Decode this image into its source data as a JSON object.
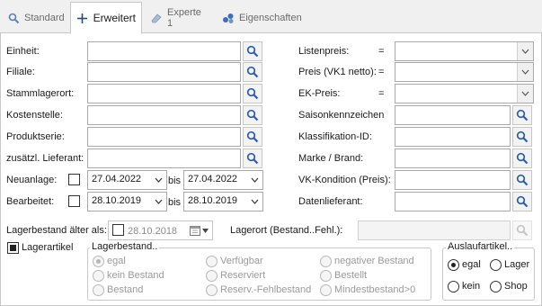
{
  "tabs": [
    {
      "label": "Standard",
      "icon": "search-icon"
    },
    {
      "label": "Erweitert",
      "icon": "plus-icon"
    },
    {
      "label": "Experte 1",
      "icon": "eraser-icon"
    },
    {
      "label": "Eigenschaften",
      "icon": "properties-icon"
    }
  ],
  "left_fields": {
    "einheit": "Einheit:",
    "filiale": "Filiale:",
    "stammlagerort": "Stammlagerort:",
    "kostenstelle": "Kostenstelle:",
    "produktserie": "Produktserie:",
    "lieferant": "zusätzl. Lieferant:"
  },
  "neuanlage": {
    "label": "Neuanlage:",
    "from": "27.04.2022",
    "bis": "bis",
    "to": "27.04.2022"
  },
  "bearbeitet": {
    "label": "Bearbeitet:",
    "from": "28.10.2019",
    "bis": "bis",
    "to": "28.10.2019"
  },
  "right_fields": {
    "listenpreis": "Listenpreis:",
    "preis_vk1": "Preis (VK1 netto):",
    "ek_preis": "EK-Preis:",
    "eq": "=",
    "saisonkennzeichen": "Saisonkennzeichen",
    "klassifikation": "Klassifikation-ID:",
    "marke": "Marke / Brand:",
    "vk_kondition": "VK-Kondition (Preis):",
    "datenlieferant": "Datenlieferant:"
  },
  "lagerbestand_aelter": {
    "label": "Lagerbestand älter als:",
    "date": "28.10.2018"
  },
  "lagerort": {
    "label": "Lagerort (Bestand..Fehl.):"
  },
  "lagerartikel": {
    "label": "Lagerartikel",
    "checked": true
  },
  "lagerbestand_group": {
    "title": "Lagerbestand..",
    "options": [
      "egal",
      "Verfügbar",
      "negativer Bestand",
      "kein Bestand",
      "Reserviert",
      "Bestellt",
      "Bestand",
      "Reserv.-Fehlbestand",
      "Mindestbestand>0"
    ],
    "selected": "egal"
  },
  "auslauf_group": {
    "title": "Auslaufartikel..",
    "options": [
      "egal",
      "Lager",
      "kein",
      "Shop"
    ],
    "selected": "egal"
  },
  "colors": {
    "search_icon": "#2a5db0",
    "accent": "#2a5db0"
  }
}
